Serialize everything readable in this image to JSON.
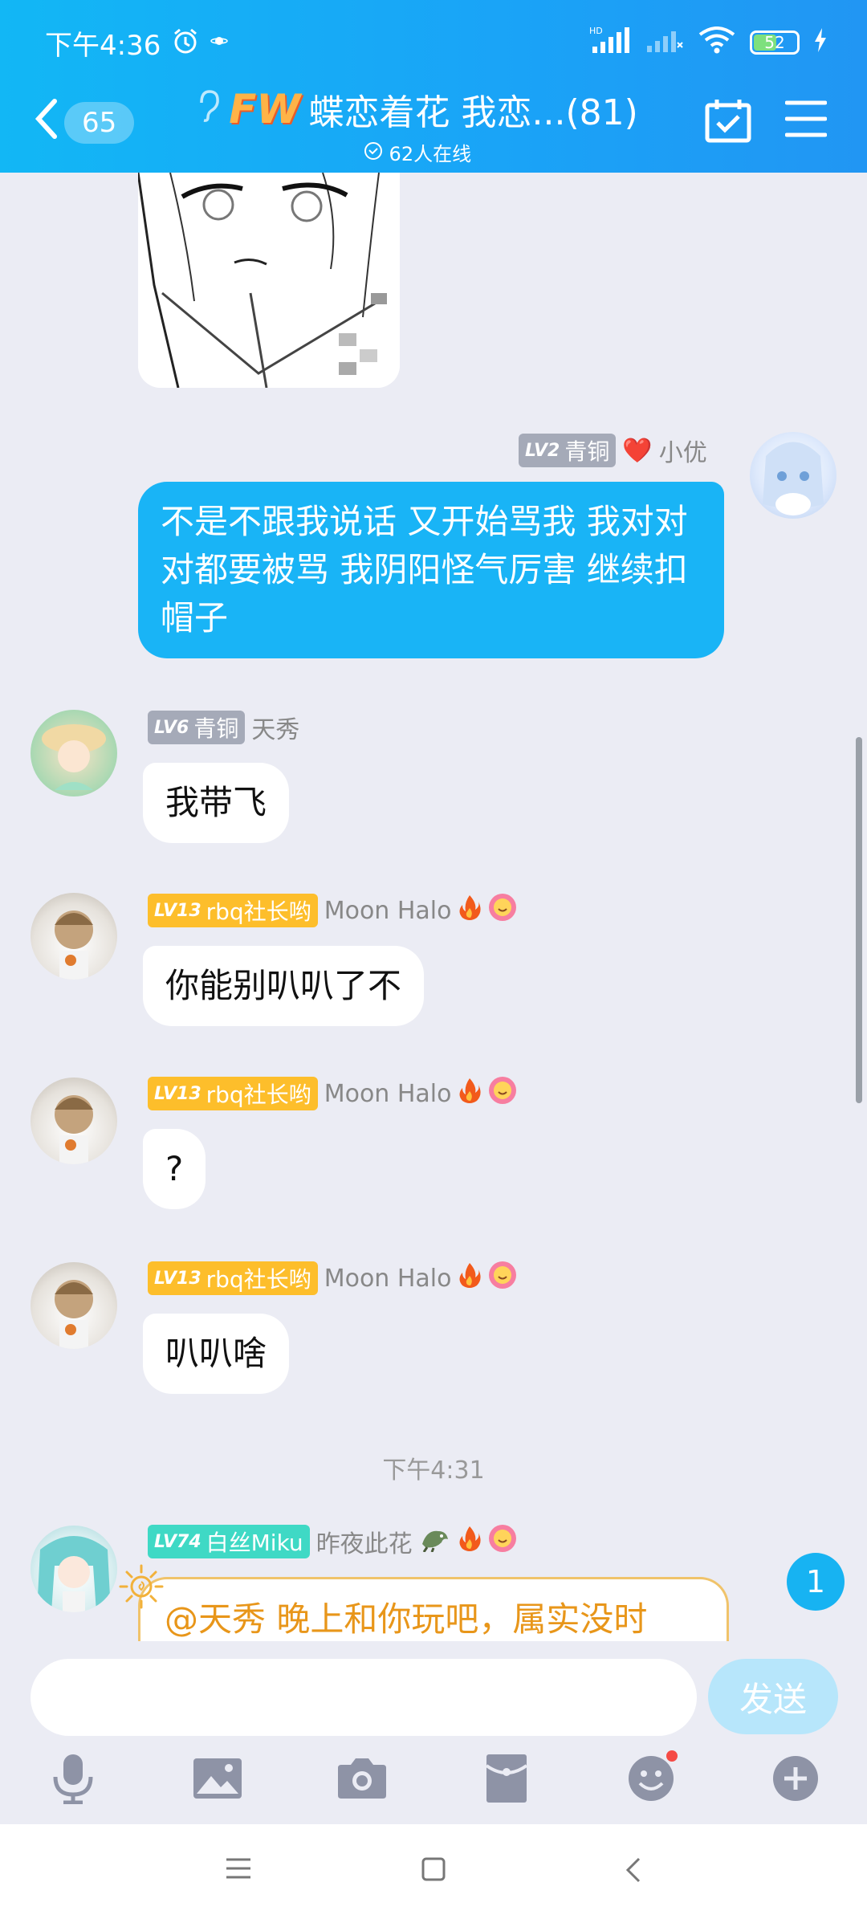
{
  "status_bar": {
    "time": "下午4:36",
    "battery": "52",
    "hd": "HD"
  },
  "header": {
    "unread_count": "65",
    "group_badge": "FW",
    "group_title": "蝶恋着花 我恋...(81)",
    "online": "62人在线"
  },
  "messages": [
    {
      "sender": "小优",
      "level": "LV2",
      "rank": "青铜",
      "heart": "❤️",
      "text": "不是不跟我说话 又开始骂我 我对对对都要被骂 我阴阳怪气厉害 继续扣帽子"
    },
    {
      "sender": "天秀",
      "level": "LV6",
      "rank": "青铜",
      "text": "我带飞"
    },
    {
      "sender": "Moon Halo",
      "level": "LV13",
      "rank": "rbq社长哟",
      "text": "你能别叭叭了不"
    },
    {
      "sender": "Moon Halo",
      "level": "LV13",
      "rank": "rbq社长哟",
      "text": "?"
    },
    {
      "sender": "Moon Halo",
      "level": "LV13",
      "rank": "rbq社长哟",
      "text": "叭叭啥"
    },
    {
      "sender": "昨夜此花",
      "level": "LV74",
      "rank": "白丝Miku",
      "text": "@天秀 晚上和你玩吧，属实没时"
    }
  ],
  "time_separator": "下午4:31",
  "new_message_badge": "1",
  "input": {
    "placeholder": "",
    "send_label": "发送"
  },
  "colors": {
    "accent": "#12b7f5",
    "bubble_out": "#19b4f6",
    "gold": "#fdbe2b",
    "teal": "#3fd9c5"
  },
  "toolbar_icons": [
    "microphone-icon",
    "image-icon",
    "camera-icon",
    "red-packet-icon",
    "emoji-icon",
    "plus-icon"
  ]
}
